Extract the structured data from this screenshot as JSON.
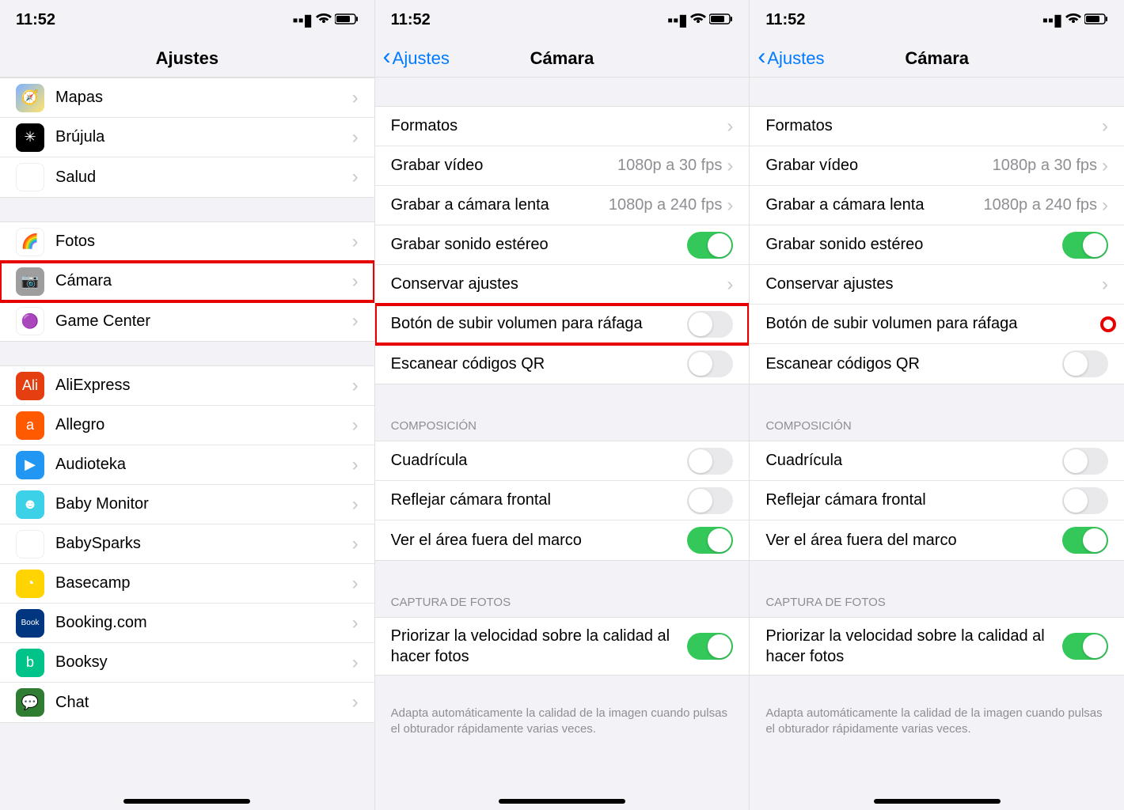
{
  "status": {
    "time": "11:52"
  },
  "screen1": {
    "title": "Ajustes",
    "group1": [
      {
        "label": "Mapas"
      },
      {
        "label": "Brújula"
      },
      {
        "label": "Salud"
      }
    ],
    "group2": [
      {
        "label": "Fotos"
      },
      {
        "label": "Cámara"
      },
      {
        "label": "Game Center"
      }
    ],
    "group3": [
      {
        "label": "AliExpress"
      },
      {
        "label": "Allegro"
      },
      {
        "label": "Audioteka"
      },
      {
        "label": "Baby Monitor"
      },
      {
        "label": "BabySparks"
      },
      {
        "label": "Basecamp"
      },
      {
        "label": "Booking.com"
      },
      {
        "label": "Booksy"
      },
      {
        "label": "Chat"
      }
    ]
  },
  "camera": {
    "back": "Ajustes",
    "title": "Cámara",
    "rows": {
      "formatos": "Formatos",
      "video": {
        "label": "Grabar vídeo",
        "value": "1080p a 30 fps"
      },
      "slow": {
        "label": "Grabar a cámara lenta",
        "value": "1080p a 240 fps"
      },
      "stereo": "Grabar sonido estéreo",
      "conservar": "Conservar ajustes",
      "burst": "Botón de subir volumen para ráfaga",
      "qr": "Escanear códigos QR"
    },
    "composicion_header": "Composición",
    "comp": {
      "grid": "Cuadrícula",
      "mirror": "Reflejar cámara frontal",
      "outside": "Ver el área fuera del marco"
    },
    "captura_header": "Captura de fotos",
    "prior": "Priorizar la velocidad sobre la calidad al hacer fotos",
    "footer": "Adapta automáticamente la calidad de la imagen cuando pulsas el obturador rápidamente varias veces."
  },
  "toggles": {
    "screen2": {
      "stereo": true,
      "burst": false,
      "qr": false,
      "grid": false,
      "mirror": false,
      "outside": true,
      "prior": true
    },
    "screen3": {
      "stereo": true,
      "burst": true,
      "qr": false,
      "grid": false,
      "mirror": false,
      "outside": true,
      "prior": true
    }
  }
}
